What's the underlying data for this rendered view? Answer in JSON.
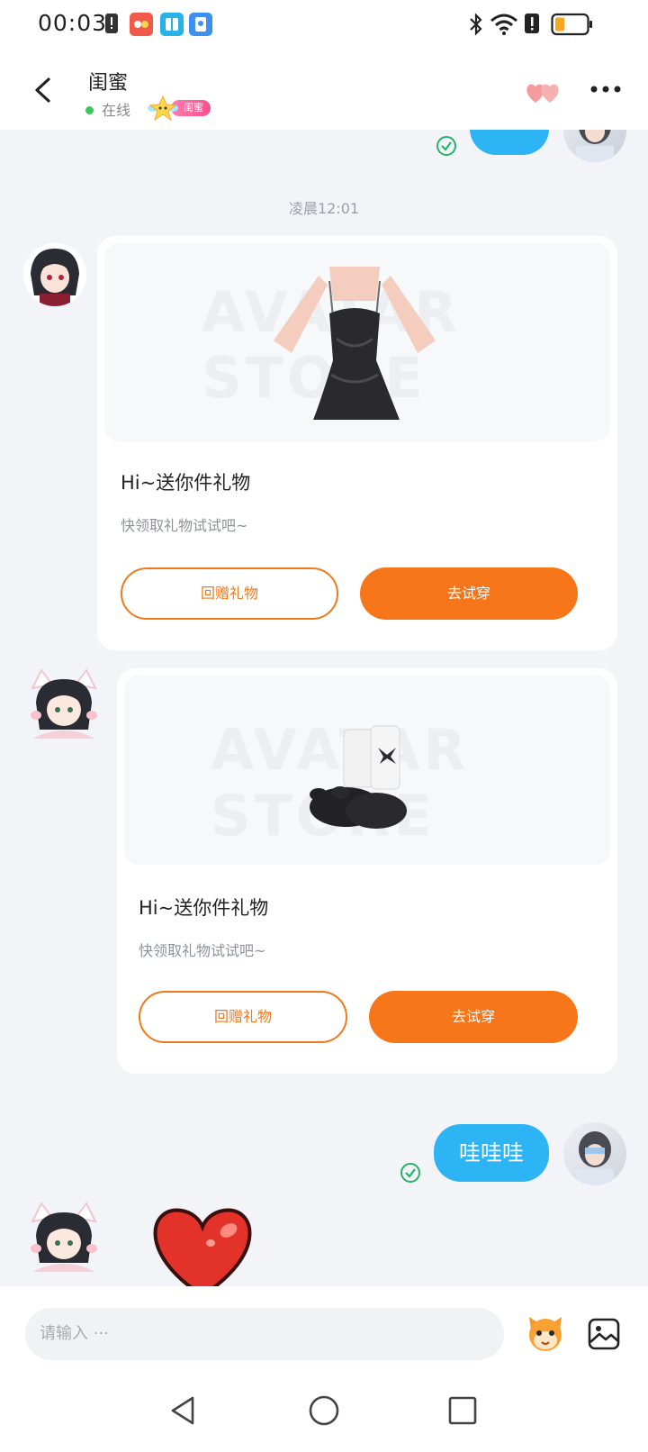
{
  "status_bar": {
    "time": "00:03",
    "icons": [
      "notification-icon",
      "app-icon-1",
      "app-icon-2",
      "app-icon-3",
      "bluetooth-icon",
      "wifi-icon",
      "alert-icon",
      "battery-icon"
    ]
  },
  "header": {
    "title": "闺蜜",
    "status": "在线",
    "badge": "闺蜜"
  },
  "chat": {
    "timestamp": "凌晨12:01",
    "messages": [
      {
        "type": "gift",
        "title": "Hi~送你件礼物",
        "subtitle": "快领取礼物试试吧~",
        "return_button": "回赠礼物",
        "try_button": "去试穿",
        "watermark": "AVATAR STORE"
      },
      {
        "type": "gift",
        "title": "Hi~送你件礼物",
        "subtitle": "快领取礼物试试吧~",
        "return_button": "回赠礼物",
        "try_button": "去试穿",
        "watermark": "AVATAR STORE"
      },
      {
        "type": "text",
        "from": "me",
        "text": "哇哇哇"
      }
    ]
  },
  "input": {
    "placeholder": "请输入 ···"
  },
  "colors": {
    "accent": "#f7761a",
    "bubble": "#2db4f5",
    "online": "#35c759"
  }
}
